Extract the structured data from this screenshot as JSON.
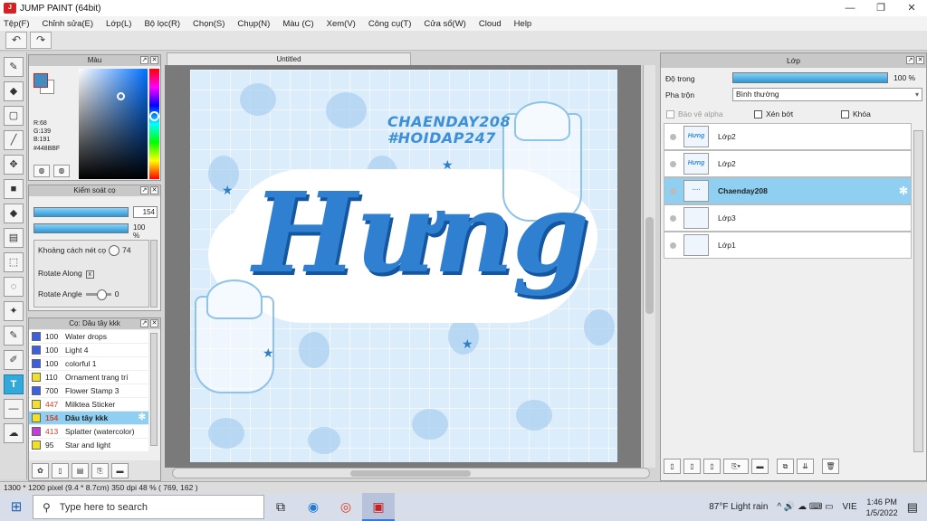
{
  "window": {
    "title": "JUMP PAINT (64bit)",
    "logo_text": "PAINT",
    "minimize": "—",
    "maximize": "❐",
    "close": "✕"
  },
  "menu": [
    "Tệp(F)",
    "Chỉnh sửa(E)",
    "Lớp(L)",
    "Bộ lọc(R)",
    "Chọn(S)",
    "Chụp(N)",
    "Màu (C)",
    "Xem(V)",
    "Công cụ(T)",
    "Cửa sổ(W)",
    "Cloud",
    "Help"
  ],
  "toolbar": {
    "undo_icon": "↶",
    "redo_icon": "↷"
  },
  "tools": {
    "brush": "✎",
    "eraser": "◆",
    "select_rect": "▢",
    "eyedropper": "╱",
    "move": "✥",
    "fill_rect": "■",
    "bucket": "◆",
    "gradient": "▤",
    "lasso_rect": "⬚",
    "lasso": "◌",
    "magic_wand": "✦",
    "edit": "✎",
    "stamp": "✐",
    "text": "T",
    "line": "—",
    "cloud": "☁"
  },
  "color_panel": {
    "title": "Màu",
    "r": "R:68",
    "g": "G:139",
    "b": "B:191",
    "hex": "#448BBF",
    "main_color": "#448BBF",
    "hue": 205,
    "saturation": 0.64,
    "value": 0.75
  },
  "brush_control": {
    "title": "Kiểm soát cọ",
    "size": "154",
    "opacity": "100 %",
    "spacing_label": "Khoảng cách nét cọ",
    "spacing_value": "74",
    "rotate_along_label": "Rotate Along",
    "rotate_along_checked": "x",
    "rotate_angle_label": "Rotate Angle",
    "rotate_angle_value": "0"
  },
  "brush_list": {
    "title": "Cọ: Dâu tây kkk",
    "items": [
      {
        "num": "100",
        "name": "Water drops",
        "color": "#3d5ee0"
      },
      {
        "num": "100",
        "name": "Light 4",
        "color": "#3d5ee0"
      },
      {
        "num": "100",
        "name": "colorful 1",
        "color": "#3d5ee0"
      },
      {
        "num": "110",
        "name": "Ornament trang trí",
        "color": "#f1e02a"
      },
      {
        "num": "700",
        "name": "Flower Stamp 3",
        "color": "#3d5ee0"
      },
      {
        "num": "447",
        "name": "Milktea Sticker",
        "color": "#f1e02a"
      },
      {
        "num": "154",
        "name": "Dâu tây kkk",
        "color": "#f1e02a"
      },
      {
        "num": "413",
        "name": "Splatter (watercolor)",
        "color": "#c23ed6"
      },
      {
        "num": "95",
        "name": "Star and light",
        "color": "#f1e02a"
      }
    ],
    "selected_index": 6
  },
  "document": {
    "tab": "Untitled"
  },
  "artwork": {
    "tag1": "CHAENDAY208",
    "tag2": "#HOIDAP247",
    "title": "Hưng"
  },
  "layers": {
    "title": "Lớp",
    "opacity_label": "Độ trong",
    "opacity_value": "100 %",
    "blend_label": "Pha trộn",
    "blend_value": "Bình thường",
    "protect_alpha": "Bảo vệ alpha",
    "clipping": "Xén bớt",
    "lock": "Khóa",
    "items": [
      {
        "name": "Lớp2",
        "thumb": "Hưng"
      },
      {
        "name": "Lớp2",
        "thumb": "Hưng"
      },
      {
        "name": "Chaenday208",
        "thumb": "····"
      },
      {
        "name": "Lớp3",
        "thumb": ""
      },
      {
        "name": "Lớp1",
        "thumb": ""
      }
    ],
    "selected_index": 2,
    "gear_icon": "✻"
  },
  "status": {
    "text": "1300 * 1200 pixel  (9.4 * 8.7cm)  350 dpi  48 %  ( 769, 162 )"
  },
  "taskbar": {
    "search_placeholder": "Type here to search",
    "weather": "87°F  Light rain",
    "lang": "VIE",
    "time": "1:46 PM",
    "date": "1/5/2022",
    "start_icon": "⊞",
    "search_icon": "⚲",
    "taskview_icon": "⧉",
    "edge_icon": "◉",
    "chrome_icon": "◎",
    "paint_icon": "▣",
    "tray_icons": "^  🔊  ☁  ⌨  ▭",
    "notif_icon": "▤"
  }
}
